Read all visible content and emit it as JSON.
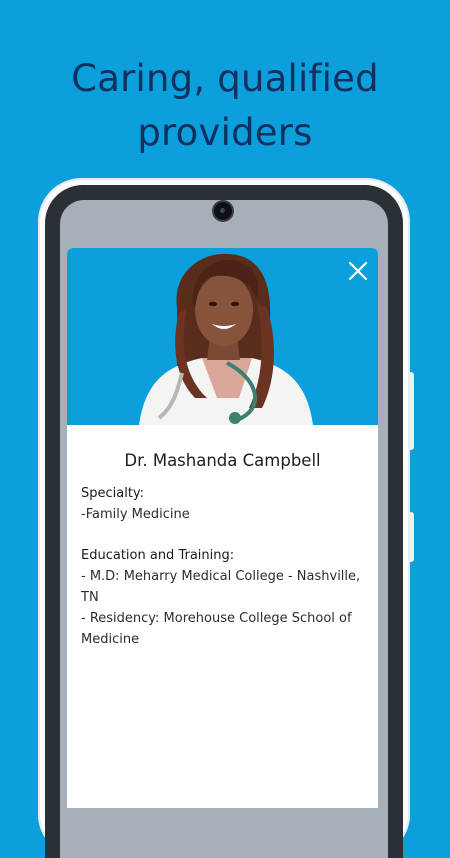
{
  "headline": {
    "line1": "Caring, qualified",
    "line2": "providers"
  },
  "colors": {
    "background": "#0b9fdb",
    "headline": "#12305e",
    "photo_bg": "#0b9fdb"
  },
  "icons": {
    "close": "close-icon",
    "camera": "front-camera"
  },
  "provider": {
    "name": "Dr. Mashanda Campbell",
    "specialty_label": "Specialty:",
    "specialty_value": "-Family Medicine",
    "education_label": "Education and Training:",
    "education_line1": "- M.D: Meharry Medical College - Nashville, TN",
    "education_line2": "- Residency: Morehouse College School of Medicine"
  }
}
